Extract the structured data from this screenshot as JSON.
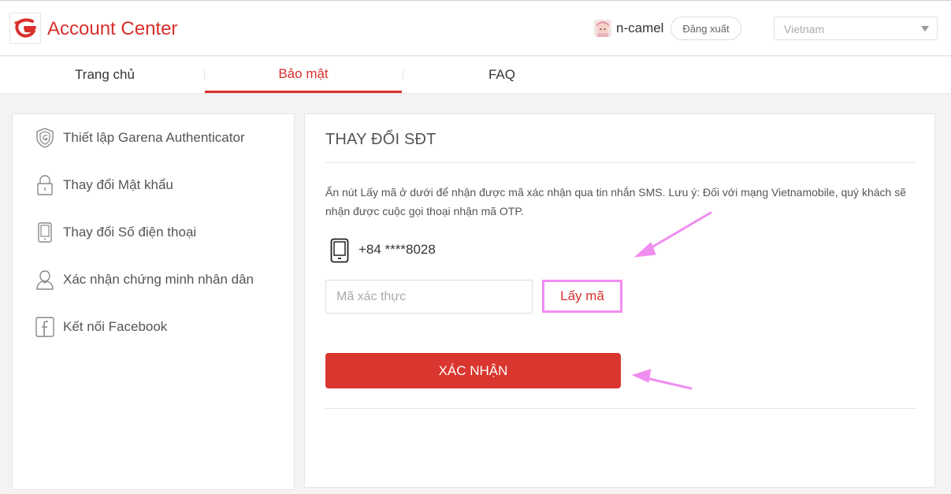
{
  "header": {
    "app_title": "Account Center",
    "username": "n-camel",
    "logout_label": "Đăng xuất",
    "region": "Vietnam"
  },
  "tabs": [
    {
      "label": "Trang chủ",
      "active": false
    },
    {
      "label": "Bảo mật",
      "active": true
    },
    {
      "label": "FAQ",
      "active": false
    }
  ],
  "sidebar": {
    "items": [
      {
        "label": "Thiết lập Garena Authenticator",
        "icon": "shield-icon"
      },
      {
        "label": "Thay đổi Mật khẩu",
        "icon": "lock-icon"
      },
      {
        "label": "Thay đổi Số điện thoại",
        "icon": "phone-icon"
      },
      {
        "label": "Xác nhận chứng minh nhân dân",
        "icon": "person-icon"
      },
      {
        "label": "Kết nối Facebook",
        "icon": "facebook-icon"
      }
    ]
  },
  "main": {
    "title": "THAY ĐỔI SĐT",
    "description": "Ấn nút Lấy mã ở dưới để nhận được mã xác nhận qua tin nhắn SMS. Lưu ý: Đối với mạng Vietnamobile, quý khách sẽ nhận được cuộc gọi thoại nhận mã OTP.",
    "phone_number": "+84 ****8028",
    "code_placeholder": "Mã xác thực",
    "code_value": "",
    "get_code_label": "Lấy mã",
    "confirm_label": "XÁC NHẬN"
  },
  "colors": {
    "brand": "#d9302c",
    "annotation": "#f08ef0"
  }
}
